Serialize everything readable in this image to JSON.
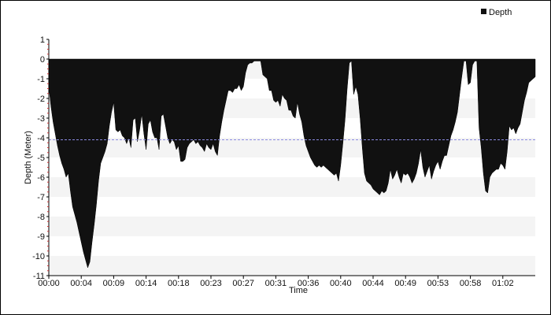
{
  "chart_data": {
    "type": "area",
    "xlabel": "Time",
    "ylabel": "Depth (Meter)",
    "x_ticks": [
      "00:00",
      "00:04",
      "00:09",
      "00:14",
      "00:18",
      "00:23",
      "00:27",
      "00:31",
      "00:36",
      "00:40",
      "00:44",
      "00:49",
      "00:53",
      "00:58",
      "01:02"
    ],
    "x_tick_minutes": [
      0,
      4.5,
      9,
      13.5,
      18,
      22.5,
      27,
      31.5,
      36,
      40.5,
      45,
      49.5,
      54,
      58.5,
      63
    ],
    "xlim": [
      0,
      67.5
    ],
    "ylim": [
      -11,
      1
    ],
    "y_ticks": [
      1,
      0,
      -1,
      -2,
      -3,
      -4,
      -5,
      -6,
      -7,
      -8,
      -9,
      -10,
      -11
    ],
    "grid": "alternating horizontal bands",
    "reference_line": {
      "y": -4.1,
      "style": "dashed",
      "color": "#8a8ae0"
    },
    "legend": {
      "position": "top-right",
      "entries": [
        "Depth"
      ]
    },
    "colors": {
      "fill": "#111111",
      "band": "#f4f4f4",
      "axis_tick": "#cc3333"
    },
    "series": [
      {
        "name": "Depth",
        "points": [
          [
            0.0,
            -1.4
          ],
          [
            0.3,
            -2.4
          ],
          [
            0.6,
            -3.2
          ],
          [
            0.9,
            -3.8
          ],
          [
            1.2,
            -4.4
          ],
          [
            1.5,
            -4.9
          ],
          [
            1.8,
            -5.3
          ],
          [
            2.1,
            -5.6
          ],
          [
            2.4,
            -6.0
          ],
          [
            2.7,
            -5.8
          ],
          [
            3.0,
            -6.7
          ],
          [
            3.3,
            -7.5
          ],
          [
            3.6,
            -7.9
          ],
          [
            3.9,
            -8.3
          ],
          [
            4.2,
            -8.8
          ],
          [
            4.5,
            -9.3
          ],
          [
            4.8,
            -9.8
          ],
          [
            5.1,
            -10.2
          ],
          [
            5.4,
            -10.6
          ],
          [
            5.7,
            -10.3
          ],
          [
            6.0,
            -9.3
          ],
          [
            6.3,
            -8.4
          ],
          [
            6.6,
            -7.4
          ],
          [
            6.9,
            -6.2
          ],
          [
            7.2,
            -5.3
          ],
          [
            7.5,
            -5.0
          ],
          [
            7.8,
            -4.7
          ],
          [
            8.1,
            -4.3
          ],
          [
            8.4,
            -3.4
          ],
          [
            8.7,
            -2.7
          ],
          [
            9.0,
            -2.2
          ],
          [
            9.3,
            -3.6
          ],
          [
            9.6,
            -3.7
          ],
          [
            9.9,
            -3.6
          ],
          [
            10.2,
            -3.9
          ],
          [
            10.5,
            -4.0
          ],
          [
            10.8,
            -4.3
          ],
          [
            11.1,
            -4.0
          ],
          [
            11.4,
            -4.5
          ],
          [
            11.7,
            -3.1
          ],
          [
            12.0,
            -3.0
          ],
          [
            12.3,
            -4.2
          ],
          [
            12.6,
            -3.6
          ],
          [
            12.9,
            -2.8
          ],
          [
            13.2,
            -3.8
          ],
          [
            13.5,
            -4.6
          ],
          [
            13.8,
            -3.3
          ],
          [
            14.1,
            -3.1
          ],
          [
            14.4,
            -3.7
          ],
          [
            14.7,
            -4.0
          ],
          [
            15.0,
            -4.0
          ],
          [
            15.3,
            -4.6
          ],
          [
            15.6,
            -2.9
          ],
          [
            15.9,
            -2.8
          ],
          [
            16.2,
            -3.4
          ],
          [
            16.5,
            -4.0
          ],
          [
            16.8,
            -4.3
          ],
          [
            17.1,
            -4.1
          ],
          [
            17.4,
            -4.2
          ],
          [
            17.7,
            -4.6
          ],
          [
            18.0,
            -4.4
          ],
          [
            18.3,
            -5.2
          ],
          [
            18.6,
            -5.2
          ],
          [
            18.9,
            -5.1
          ],
          [
            19.2,
            -4.5
          ],
          [
            19.5,
            -4.3
          ],
          [
            19.8,
            -4.2
          ],
          [
            20.1,
            -4.1
          ],
          [
            20.4,
            -4.3
          ],
          [
            20.7,
            -4.2
          ],
          [
            21.0,
            -4.4
          ],
          [
            21.3,
            -4.5
          ],
          [
            21.6,
            -4.7
          ],
          [
            21.9,
            -4.3
          ],
          [
            22.2,
            -4.5
          ],
          [
            22.5,
            -4.6
          ],
          [
            22.8,
            -4.3
          ],
          [
            23.1,
            -4.7
          ],
          [
            23.4,
            -4.9
          ],
          [
            23.7,
            -3.9
          ],
          [
            24.0,
            -3.2
          ],
          [
            24.3,
            -2.6
          ],
          [
            24.6,
            -2.1
          ],
          [
            24.9,
            -1.6
          ],
          [
            25.2,
            -1.6
          ],
          [
            25.5,
            -1.7
          ],
          [
            25.8,
            -1.5
          ],
          [
            26.1,
            -1.5
          ],
          [
            26.4,
            -1.3
          ],
          [
            26.7,
            -1.6
          ],
          [
            27.0,
            -1.4
          ],
          [
            27.3,
            -0.7
          ],
          [
            27.6,
            -0.3
          ],
          [
            27.9,
            -0.2
          ],
          [
            28.2,
            -0.2
          ],
          [
            28.5,
            -0.1
          ],
          [
            28.8,
            -0.1
          ],
          [
            29.1,
            -0.1
          ],
          [
            29.4,
            -0.1
          ],
          [
            29.7,
            -0.8
          ],
          [
            30.0,
            -0.9
          ],
          [
            30.3,
            -1.0
          ],
          [
            30.6,
            -1.6
          ],
          [
            30.9,
            -1.6
          ],
          [
            31.2,
            -2.1
          ],
          [
            31.5,
            -2.2
          ],
          [
            31.8,
            -2.1
          ],
          [
            32.1,
            -2.4
          ],
          [
            32.4,
            -1.8
          ],
          [
            32.7,
            -2.0
          ],
          [
            33.0,
            -2.1
          ],
          [
            33.3,
            -2.6
          ],
          [
            33.6,
            -2.6
          ],
          [
            33.9,
            -2.9
          ],
          [
            34.2,
            -3.0
          ],
          [
            34.5,
            -2.2
          ],
          [
            34.8,
            -2.8
          ],
          [
            35.1,
            -3.2
          ],
          [
            35.4,
            -3.9
          ],
          [
            35.7,
            -4.4
          ],
          [
            36.0,
            -4.7
          ],
          [
            36.3,
            -5.0
          ],
          [
            36.6,
            -5.2
          ],
          [
            36.9,
            -5.4
          ],
          [
            37.2,
            -5.5
          ],
          [
            37.5,
            -5.4
          ],
          [
            37.8,
            -5.5
          ],
          [
            38.1,
            -5.4
          ],
          [
            38.4,
            -5.5
          ],
          [
            38.7,
            -5.6
          ],
          [
            39.0,
            -5.7
          ],
          [
            39.3,
            -5.8
          ],
          [
            39.6,
            -5.9
          ],
          [
            39.9,
            -5.8
          ],
          [
            40.2,
            -6.2
          ],
          [
            40.5,
            -5.4
          ],
          [
            40.8,
            -4.3
          ],
          [
            41.1,
            -3.1
          ],
          [
            41.4,
            -1.5
          ],
          [
            41.7,
            -0.2
          ],
          [
            42.0,
            -0.1
          ],
          [
            42.3,
            -1.8
          ],
          [
            42.6,
            -1.4
          ],
          [
            42.9,
            -1.8
          ],
          [
            43.2,
            -3.0
          ],
          [
            43.5,
            -4.5
          ],
          [
            43.8,
            -5.8
          ],
          [
            44.1,
            -6.2
          ],
          [
            44.4,
            -6.3
          ],
          [
            44.7,
            -6.4
          ],
          [
            45.0,
            -6.6
          ],
          [
            45.3,
            -6.7
          ],
          [
            45.6,
            -6.8
          ],
          [
            45.9,
            -6.9
          ],
          [
            46.2,
            -6.7
          ],
          [
            46.5,
            -6.8
          ],
          [
            46.8,
            -6.7
          ],
          [
            47.1,
            -6.3
          ],
          [
            47.4,
            -5.6
          ],
          [
            47.7,
            -6.1
          ],
          [
            48.0,
            -5.9
          ],
          [
            48.3,
            -5.6
          ],
          [
            48.6,
            -6.0
          ],
          [
            48.9,
            -6.3
          ],
          [
            49.2,
            -5.8
          ],
          [
            49.5,
            -5.9
          ],
          [
            49.8,
            -5.8
          ],
          [
            50.1,
            -6.0
          ],
          [
            50.4,
            -6.3
          ],
          [
            50.7,
            -6.1
          ],
          [
            51.0,
            -5.8
          ],
          [
            51.3,
            -5.3
          ],
          [
            51.6,
            -4.6
          ],
          [
            51.9,
            -5.5
          ],
          [
            52.2,
            -6.0
          ],
          [
            52.5,
            -5.7
          ],
          [
            52.8,
            -5.4
          ],
          [
            53.1,
            -6.1
          ],
          [
            53.4,
            -5.7
          ],
          [
            53.7,
            -5.4
          ],
          [
            54.0,
            -5.2
          ],
          [
            54.3,
            -5.6
          ],
          [
            54.6,
            -5.2
          ],
          [
            54.9,
            -4.9
          ],
          [
            55.2,
            -4.9
          ],
          [
            55.5,
            -4.4
          ],
          [
            55.8,
            -3.9
          ],
          [
            56.1,
            -3.6
          ],
          [
            56.4,
            -3.2
          ],
          [
            56.7,
            -2.7
          ],
          [
            57.0,
            -1.8
          ],
          [
            57.3,
            -0.9
          ],
          [
            57.6,
            -0.1
          ],
          [
            57.9,
            -0.1
          ],
          [
            58.2,
            -1.3
          ],
          [
            58.5,
            -1.2
          ],
          [
            58.8,
            -0.3
          ],
          [
            59.1,
            -0.1
          ],
          [
            59.4,
            -0.1
          ],
          [
            59.7,
            -3.5
          ],
          [
            60.0,
            -4.5
          ],
          [
            60.3,
            -5.8
          ],
          [
            60.6,
            -6.7
          ],
          [
            60.9,
            -6.8
          ],
          [
            61.2,
            -6.0
          ],
          [
            61.5,
            -5.8
          ],
          [
            61.8,
            -5.7
          ],
          [
            62.1,
            -5.6
          ],
          [
            62.4,
            -5.6
          ],
          [
            62.7,
            -5.3
          ],
          [
            63.0,
            -5.4
          ],
          [
            63.3,
            -5.6
          ],
          [
            63.6,
            -4.7
          ],
          [
            63.9,
            -3.4
          ],
          [
            64.2,
            -3.6
          ],
          [
            64.5,
            -3.5
          ],
          [
            64.8,
            -3.8
          ],
          [
            65.1,
            -3.5
          ],
          [
            65.4,
            -3.3
          ],
          [
            65.7,
            -2.7
          ],
          [
            66.0,
            -2.1
          ],
          [
            66.3,
            -1.7
          ],
          [
            66.6,
            -1.2
          ],
          [
            66.9,
            -1.1
          ],
          [
            67.2,
            -1.0
          ],
          [
            67.5,
            -0.9
          ]
        ]
      }
    ]
  }
}
